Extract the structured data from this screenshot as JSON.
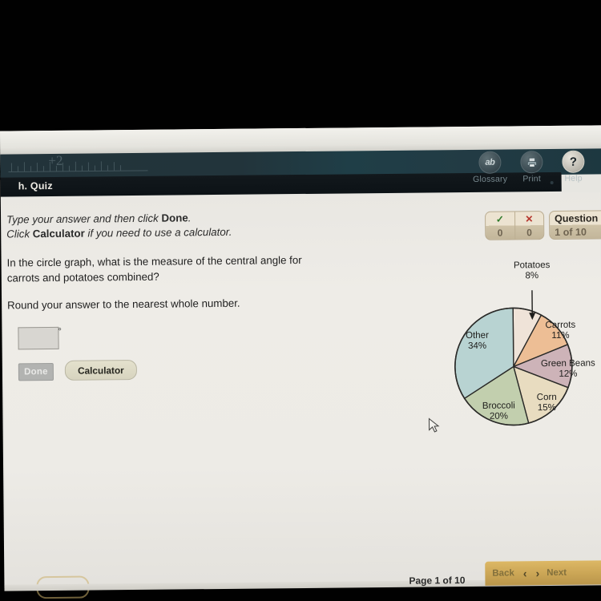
{
  "header": {
    "title": "h. Quiz",
    "plus_label": "+2",
    "icons": [
      {
        "name": "glossary-icon",
        "glyph": "ab",
        "label": "Glossary"
      },
      {
        "name": "print-icon",
        "glyph": "⎙",
        "label": "Print"
      },
      {
        "name": "help-icon",
        "glyph": "?",
        "label": "Help"
      }
    ]
  },
  "instructions": {
    "line1_a": "Type your answer and then click ",
    "line1_b": "Done",
    "line1_c": ".",
    "line2_a": "Click ",
    "line2_b": "Calculator",
    "line2_c": " if you need to use a calculator."
  },
  "question": {
    "text": "In the circle graph, what is the measure of the central angle for carrots and potatoes combined?",
    "round_note": "Round your answer to the nearest whole number.",
    "answer_value": "",
    "answer_placeholder": "",
    "degree_symbol": "°"
  },
  "buttons": {
    "done": "Done",
    "calculator": "Calculator"
  },
  "score": {
    "correct_icon": "✓",
    "incorrect_icon": "✕",
    "correct_count": "0",
    "incorrect_count": "0",
    "question_label": "Question",
    "question_progress": "1 of 10"
  },
  "footer": {
    "page_label": "Page  1 of 10",
    "back": "Back",
    "prev_arrow": "‹",
    "next_arrow": "›",
    "next": "Next"
  },
  "chart_data": {
    "type": "pie",
    "title": "",
    "categories": [
      "Potatoes",
      "Carrots",
      "Green Beans",
      "Corn",
      "Broccoli",
      "Other"
    ],
    "values": [
      8,
      11,
      12,
      15,
      20,
      34
    ],
    "labels": [
      "Potatoes\n8%",
      "Carrots\n11%",
      "Green Beans\n12%",
      "Corn\n15%",
      "Broccoli\n20%",
      "Other\n34%"
    ],
    "colors": [
      "#efe3d8",
      "#edbe95",
      "#cdb3b8",
      "#e8dcc0",
      "#c2cfae",
      "#b8d3d2"
    ],
    "start_angle_deg": 0,
    "direction": "clockwise",
    "legend": "none",
    "annotation": {
      "text": "Potatoes 8%",
      "type": "leader-arrow",
      "points_to": "Potatoes"
    },
    "slices": [
      {
        "name": "Potatoes",
        "percent": 8,
        "pct_label": "8%",
        "color": "#efe3d8"
      },
      {
        "name": "Carrots",
        "percent": 11,
        "pct_label": "11%",
        "color": "#edbe95"
      },
      {
        "name": "Green Beans",
        "percent": 12,
        "pct_label": "12%",
        "color": "#cdb3b8"
      },
      {
        "name": "Corn",
        "percent": 15,
        "pct_label": "15%",
        "color": "#e8dcc0"
      },
      {
        "name": "Broccoli",
        "percent": 20,
        "pct_label": "20%",
        "color": "#c2cfae"
      },
      {
        "name": "Other",
        "percent": 34,
        "pct_label": "34%",
        "color": "#b8d3d2"
      }
    ]
  }
}
